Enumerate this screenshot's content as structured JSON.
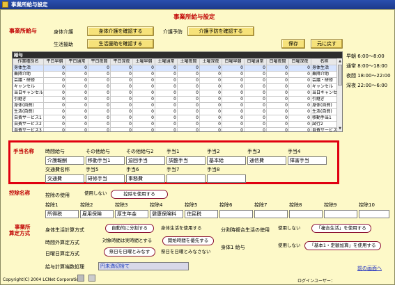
{
  "window": {
    "title": "事業所給与設定"
  },
  "page_title": "事業所給与設定",
  "kyuyo_section": {
    "title": "事業所給与",
    "shintai_label": "身体介護",
    "shintai_button": "身体介護を確認する",
    "kaigo_yobo_label": "介護予防",
    "kaigo_yobo_button": "介護予防を確認する",
    "seikatsu_label": "生活援助",
    "seikatsu_button": "生活援助を確認する",
    "save_button": "保存",
    "reset_button": "元に戻す"
  },
  "grid": {
    "title": "給与",
    "columns": [
      "作業種別名",
      "平日早朝",
      "平日通常",
      "平日夜間",
      "平日深夜",
      "土曜早朝",
      "土曜通常",
      "土曜夜間",
      "土曜深夜",
      "日曜早朝",
      "日曜通常",
      "日曜夜間",
      "日曜深夜",
      "名称"
    ],
    "rows": [
      {
        "name": "身体生活",
        "values": [
          "0",
          "0",
          "0",
          "0",
          "0",
          "0",
          "0",
          "0",
          "0",
          "0",
          "0",
          "0"
        ],
        "label": "身体生活"
      },
      {
        "name": "乗降介助",
        "values": [
          "0",
          "0",
          "0",
          "0",
          "0",
          "0",
          "0",
          "0",
          "0",
          "0",
          "0",
          "0"
        ],
        "label": "乗降介助"
      },
      {
        "name": "会議・研修",
        "values": [
          "0",
          "0",
          "0",
          "0",
          "0",
          "0",
          "0",
          "0",
          "0",
          "0",
          "0",
          "0"
        ],
        "label": "会議・研修"
      },
      {
        "name": "キャンセル",
        "values": [
          "0",
          "0",
          "0",
          "0",
          "0",
          "0",
          "0",
          "0",
          "0",
          "0",
          "0",
          "0"
        ],
        "label": "キャンセル"
      },
      {
        "name": "当日キャンセル",
        "values": [
          "0",
          "0",
          "0",
          "0",
          "0",
          "0",
          "0",
          "0",
          "0",
          "0",
          "0",
          "0"
        ],
        "label": "当日キャンセル"
      },
      {
        "name": "引継ぎ",
        "values": [
          "0",
          "0",
          "0",
          "0",
          "0",
          "0",
          "0",
          "0",
          "0",
          "0",
          "0",
          "0"
        ],
        "label": "引継ぎ"
      },
      {
        "name": "身体(自費)",
        "values": [
          "0",
          "0",
          "0",
          "0",
          "0",
          "0",
          "0",
          "0",
          "0",
          "0",
          "0",
          "0"
        ],
        "label": "身体(自費)"
      },
      {
        "name": "生活(自費)",
        "values": [
          "0",
          "0",
          "0",
          "0",
          "0",
          "0",
          "0",
          "0",
          "0",
          "0",
          "0",
          "0"
        ],
        "label": "生活(自費)"
      },
      {
        "name": "自費サービス1",
        "values": [
          "0",
          "0",
          "0",
          "0",
          "0",
          "0",
          "0",
          "0",
          "0",
          "0",
          "0",
          "0"
        ],
        "label": "移動手当1"
      },
      {
        "name": "自費サービス2",
        "values": [
          "0",
          "0",
          "0",
          "0",
          "0",
          "0",
          "0",
          "0",
          "0",
          "0",
          "0",
          "0"
        ],
        "label": "試行2"
      },
      {
        "name": "自費サービス3",
        "values": [
          "0",
          "0",
          "0",
          "0",
          "0",
          "0",
          "0",
          "0",
          "0",
          "0",
          "0",
          "0"
        ],
        "label": "自費サービス"
      }
    ]
  },
  "time_ranges": {
    "soucho": "早朝 6:00～8:00",
    "tsujo": "通常 8:00～18:00",
    "yakan": "夜間 18:00～22:00",
    "shinya": "深夜 22:00～6:00"
  },
  "teate": {
    "title": "手当名称",
    "headers": [
      "時間給与",
      "その他給与",
      "その他給与2",
      "手当1",
      "手当2",
      "手当3",
      "手当4"
    ],
    "values": [
      "介護報酬",
      "移動手当1",
      "迫回手当",
      "調整手当",
      "基本給",
      "通信費",
      "障害手当"
    ],
    "headers2": [
      "交通費名称",
      "手当5",
      "手当6",
      "手当7",
      "手当8"
    ],
    "values2": [
      "交通費",
      "研修手当",
      "事務費",
      "",
      ""
    ]
  },
  "kojo": {
    "title": "控除名称",
    "use_label": "控除の使用",
    "option_off": "使用しない",
    "option_on": "控除を使用する",
    "headers": [
      "控除1",
      "控除2",
      "控除3",
      "控除4",
      "控除5",
      "控除6",
      "控除7",
      "控除8",
      "控除9",
      "控除10"
    ],
    "values": [
      "所得税",
      "雇用保険",
      "厚生年金",
      "健康保険料",
      "住民税",
      "",
      "",
      "",
      "",
      ""
    ]
  },
  "santei": {
    "title_line1": "事業所",
    "title_line2": "算定方式",
    "shintai_seikatsu_label": "身体生活計算方式",
    "shintai_opt1": "自動的に分割する",
    "shintai_opt2": "身体生活を使用する",
    "bunkatsu_label": "分割時複合生活の使用",
    "bunkatsu_opt1": "使用しない",
    "bunkatsu_opt2": "「複合生活」を使用する",
    "jikantai_label": "時間外算定方式",
    "jikantai_opt1": "対象時間は実時間とする",
    "jikantai_opt2": "開始時間を優先する",
    "shintai1_label": "身体1 給与",
    "shintai1_opt1": "使用しない",
    "shintai1_opt2": "「基本1・定額加算」を使用する",
    "nichiyo_label": "日曜日算定方式",
    "nichiyo_opt1": "祭日を日曜とみなす",
    "nichiyo_opt2": "祭日を日曜とみなさない",
    "hasu_label": "給与計算端数処理",
    "hasu_value": "円未満切捨て"
  },
  "footer": {
    "copyright": "Copyright(C) 2004 LCNet Corporation",
    "login_label": "ログインユーザー：",
    "back_link": "前の画面へ"
  }
}
